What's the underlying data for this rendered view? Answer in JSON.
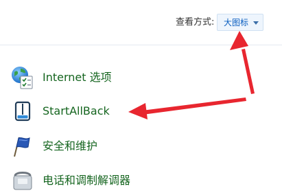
{
  "header": {
    "view_label": "查看方式:",
    "view_value": "大图标"
  },
  "items": [
    {
      "label": "Internet 选项",
      "icon": "internet-options-icon"
    },
    {
      "label": "StartAllBack",
      "icon": "startallback-icon"
    },
    {
      "label": "安全和维护",
      "icon": "flag-icon"
    },
    {
      "label": "电话和调制解调器",
      "icon": "telephone-icon"
    }
  ],
  "colors": {
    "link_green": "#15651f",
    "select_text": "#0a5ec0",
    "annotation_red": "#e8262f"
  }
}
